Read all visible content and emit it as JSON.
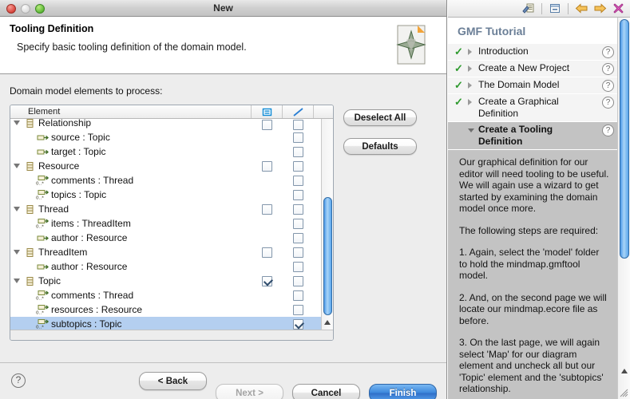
{
  "window": {
    "title": "New",
    "traffic_lights": [
      "close-button",
      "minimize-button",
      "zoom-button"
    ]
  },
  "banner": {
    "heading": "Tooling Definition",
    "subheading": "Specify basic tooling definition of the domain model.",
    "icon": "wizard-banner-icon"
  },
  "form": {
    "tree_label": "Domain model elements to process:"
  },
  "tree": {
    "columns": [
      {
        "label": "Element",
        "icon": ""
      },
      {
        "label": "",
        "icon": "node-column-icon"
      },
      {
        "label": "",
        "icon": "link-column-icon"
      }
    ],
    "rows": [
      {
        "name": "Relationship",
        "kind": "class",
        "expanded": true,
        "node": false,
        "link": false,
        "has_node": true,
        "selected": false,
        "clipped": true
      },
      {
        "name": "source : Topic",
        "kind": "reference",
        "expanded": false,
        "node": null,
        "link": false,
        "has_node": false,
        "selected": false
      },
      {
        "name": "target : Topic",
        "kind": "reference",
        "expanded": false,
        "node": null,
        "link": false,
        "has_node": false,
        "selected": false
      },
      {
        "name": "Resource",
        "kind": "class",
        "expanded": true,
        "node": false,
        "link": false,
        "has_node": true,
        "selected": false
      },
      {
        "name": "comments : Thread",
        "kind": "multiref",
        "expanded": false,
        "node": null,
        "link": false,
        "has_node": false,
        "selected": false
      },
      {
        "name": "topics : Topic",
        "kind": "multiref",
        "expanded": false,
        "node": null,
        "link": false,
        "has_node": false,
        "selected": false
      },
      {
        "name": "Thread",
        "kind": "class",
        "expanded": true,
        "node": false,
        "link": false,
        "has_node": true,
        "selected": false
      },
      {
        "name": "items : ThreadItem",
        "kind": "multiref",
        "expanded": false,
        "node": null,
        "link": false,
        "has_node": false,
        "selected": false
      },
      {
        "name": "author : Resource",
        "kind": "reference",
        "expanded": false,
        "node": null,
        "link": false,
        "has_node": false,
        "selected": false
      },
      {
        "name": "ThreadItem",
        "kind": "class",
        "expanded": true,
        "node": false,
        "link": false,
        "has_node": true,
        "selected": false
      },
      {
        "name": "author : Resource",
        "kind": "reference",
        "expanded": false,
        "node": null,
        "link": false,
        "has_node": false,
        "selected": false
      },
      {
        "name": "Topic",
        "kind": "class",
        "expanded": true,
        "node": true,
        "link": false,
        "has_node": true,
        "selected": false
      },
      {
        "name": "comments : Thread",
        "kind": "multiref",
        "expanded": false,
        "node": null,
        "link": false,
        "has_node": false,
        "selected": false
      },
      {
        "name": "resources : Resource",
        "kind": "multiref",
        "expanded": false,
        "node": null,
        "link": false,
        "has_node": false,
        "selected": false
      },
      {
        "name": "subtopics : Topic",
        "kind": "multiref",
        "expanded": false,
        "node": null,
        "link": true,
        "has_node": false,
        "selected": true
      }
    ]
  },
  "side_buttons": {
    "deselect_all": "Deselect All",
    "defaults": "Defaults"
  },
  "footer": {
    "help": "?",
    "back": "< Back",
    "next": "Next >",
    "cancel": "Cancel",
    "finish": "Finish"
  },
  "tutorial": {
    "toolbar_icons": [
      "notes-icon",
      "collapse-panel-icon",
      "back-arrow-icon",
      "forward-arrow-icon",
      "close-icon"
    ],
    "title": "GMF Tutorial",
    "sections": [
      {
        "label": "Introduction",
        "done": true,
        "check": "✓",
        "state": "collapsed",
        "help": "?"
      },
      {
        "label": "Create a New Project",
        "done": true,
        "check": "✓",
        "state": "collapsed",
        "help": "?"
      },
      {
        "label": "The Domain Model",
        "done": true,
        "check": "✓",
        "state": "collapsed",
        "help": "?"
      },
      {
        "label": "Create a Graphical Definition",
        "done": true,
        "check": "✓",
        "state": "collapsed",
        "help": "?"
      },
      {
        "label": "Create a Tooling Definition",
        "done": false,
        "check": "",
        "state": "expanded",
        "help": "?"
      }
    ],
    "content_paragraphs": [
      "Our graphical definition for our editor will need tooling to be useful. We will again use a wizard to get started by examining the domain model once more.",
      "The following steps are required:",
      "1. Again, select the 'model' folder to hold the mindmap.gmftool model.",
      "2. And, on the second page we will locate our mindmap.ecore file as before.",
      "3. On the last page, we will again select 'Map' for our diagram element and uncheck all but our 'Topic' element and the 'subtopics' relationship."
    ]
  },
  "colors": {
    "selection": "#b4cff0",
    "scrollbar": "#5aa6ec",
    "tutorial_title": "#6b7f97",
    "check_green": "#2e9a2e",
    "content_bg": "#c3c3c3"
  }
}
